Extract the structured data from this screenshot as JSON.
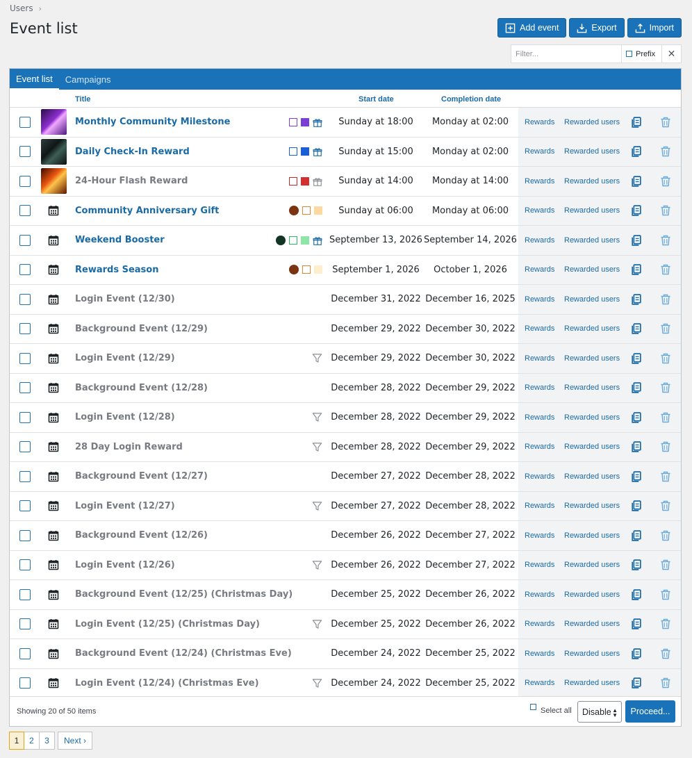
{
  "breadcrumb": {
    "root": "Users",
    "sep": "›"
  },
  "page_title": "Event list",
  "toolbar": {
    "add": "Add event",
    "export": "Export",
    "import": "Import"
  },
  "filter": {
    "placeholder": "Filter...",
    "prefix_label": "Prefix",
    "clear": "✕"
  },
  "tabs": [
    {
      "label": "Event list",
      "active": true
    },
    {
      "label": "Campaigns",
      "active": false
    }
  ],
  "columns": {
    "title": "Title",
    "start": "Start date",
    "end": "Completion date"
  },
  "row_actions": {
    "rewards": "Rewards",
    "rewarded_users": "Rewarded users"
  },
  "rows": [
    {
      "title": "Monthly Community Milestone",
      "status": "published",
      "media": "thumb-purple",
      "marks": [
        {
          "t": "sq",
          "c": "#7b3fd6",
          "f": false
        },
        {
          "t": "sq",
          "c": "#7b3fd6",
          "f": true
        },
        {
          "t": "gift",
          "c": "#1a6aa6"
        }
      ],
      "start": "Sunday at 18:00",
      "end": "Monday at 02:00"
    },
    {
      "title": "Daily Check-In Reward",
      "status": "published",
      "media": "thumb-phone",
      "marks": [
        {
          "t": "sq",
          "c": "#1a5fd8",
          "f": false
        },
        {
          "t": "sq",
          "c": "#1a5fd8",
          "f": true
        },
        {
          "t": "gift",
          "c": "#1a6aa6"
        }
      ],
      "start": "Sunday at 15:00",
      "end": "Monday at 02:00"
    },
    {
      "title": "24-Hour Flash Reward",
      "status": "draft",
      "media": "thumb-fire",
      "marks": [
        {
          "t": "sq",
          "c": "#c62828",
          "f": false
        },
        {
          "t": "sq",
          "c": "#d32f2f",
          "f": true
        },
        {
          "t": "gift",
          "c": "#8c8f94"
        }
      ],
      "start": "Sunday at 14:00",
      "end": "Monday at 14:00"
    },
    {
      "title": "Community Anniversary Gift",
      "status": "published",
      "media": "calendar",
      "marks": [
        {
          "t": "dot",
          "c": "#7a3412"
        },
        {
          "t": "sq",
          "c": "#e8852a",
          "f": false
        },
        {
          "t": "sq",
          "c": "#fbd9a0",
          "f": true
        }
      ],
      "start": "Sunday at 06:00",
      "end": "Monday at 06:00"
    },
    {
      "title": "Weekend Booster",
      "status": "published",
      "media": "calendar",
      "marks": [
        {
          "t": "dot",
          "c": "#123524"
        },
        {
          "t": "sq",
          "c": "#2fb565",
          "f": false
        },
        {
          "t": "sq",
          "c": "#8ee6a6",
          "f": true
        },
        {
          "t": "gift",
          "c": "#1a6aa6"
        }
      ],
      "start": "September 13, 2026",
      "end": "September 14, 2026"
    },
    {
      "title": "Rewards Season",
      "status": "published",
      "media": "calendar",
      "marks": [
        {
          "t": "dot",
          "c": "#7a3412"
        },
        {
          "t": "sq",
          "c": "#e8852a",
          "f": false
        },
        {
          "t": "sq",
          "c": "#fdefcc",
          "f": true
        }
      ],
      "start": "September 1, 2026",
      "end": "October 1, 2026"
    },
    {
      "title": "Login Event (12/30)",
      "status": "draft",
      "media": "calendar",
      "marks": [],
      "start": "December 31, 2022",
      "end": "December 16, 2025"
    },
    {
      "title": "Background Event (12/29)",
      "status": "draft",
      "media": "calendar",
      "marks": [],
      "start": "December 29, 2022",
      "end": "December 30, 2022"
    },
    {
      "title": "Login Event (12/29)",
      "status": "draft",
      "media": "calendar",
      "marks": [
        {
          "t": "funnel"
        }
      ],
      "start": "December 29, 2022",
      "end": "December 30, 2022"
    },
    {
      "title": "Background Event (12/28)",
      "status": "draft",
      "media": "calendar",
      "marks": [],
      "start": "December 28, 2022",
      "end": "December 29, 2022"
    },
    {
      "title": "Login Event (12/28)",
      "status": "draft",
      "media": "calendar",
      "marks": [
        {
          "t": "funnel"
        }
      ],
      "start": "December 28, 2022",
      "end": "December 29, 2022"
    },
    {
      "title": "28 Day Login Reward",
      "status": "draft",
      "media": "calendar",
      "marks": [
        {
          "t": "funnel"
        }
      ],
      "start": "December 28, 2022",
      "end": "December 29, 2022"
    },
    {
      "title": "Background Event (12/27)",
      "status": "draft",
      "media": "calendar",
      "marks": [],
      "start": "December 27, 2022",
      "end": "December 28, 2022"
    },
    {
      "title": "Login Event (12/27)",
      "status": "draft",
      "media": "calendar",
      "marks": [
        {
          "t": "funnel"
        }
      ],
      "start": "December 27, 2022",
      "end": "December 28, 2022"
    },
    {
      "title": "Background Event (12/26)",
      "status": "draft",
      "media": "calendar",
      "marks": [],
      "start": "December 26, 2022",
      "end": "December 27, 2022"
    },
    {
      "title": "Login Event (12/26)",
      "status": "draft",
      "media": "calendar",
      "marks": [
        {
          "t": "funnel"
        }
      ],
      "start": "December 26, 2022",
      "end": "December 27, 2022"
    },
    {
      "title": "Background Event (12/25) (Christmas Day)",
      "status": "draft",
      "media": "calendar",
      "marks": [],
      "start": "December 25, 2022",
      "end": "December 26, 2022"
    },
    {
      "title": "Login Event (12/25) (Christmas Day)",
      "status": "draft",
      "media": "calendar",
      "marks": [
        {
          "t": "funnel"
        }
      ],
      "start": "December 25, 2022",
      "end": "December 26, 2022"
    },
    {
      "title": "Background Event (12/24) (Christmas Eve)",
      "status": "draft",
      "media": "calendar",
      "marks": [],
      "start": "December 24, 2022",
      "end": "December 25, 2022"
    },
    {
      "title": "Login Event (12/24) (Christmas Eve)",
      "status": "draft",
      "media": "calendar",
      "marks": [
        {
          "t": "funnel"
        }
      ],
      "start": "December 24, 2022",
      "end": "December 25, 2022"
    }
  ],
  "footer": {
    "showing": "Showing 20 of 50 items",
    "select_all": "Select all",
    "bulk_value": "Disable",
    "proceed": "Proceed..."
  },
  "pagination": {
    "pages": [
      "1",
      "2",
      "3"
    ],
    "current": "1",
    "next": "Next ›"
  },
  "colors": {
    "accent": "#1a73b8",
    "link": "#1a6aa6",
    "draft": "#787c82"
  }
}
